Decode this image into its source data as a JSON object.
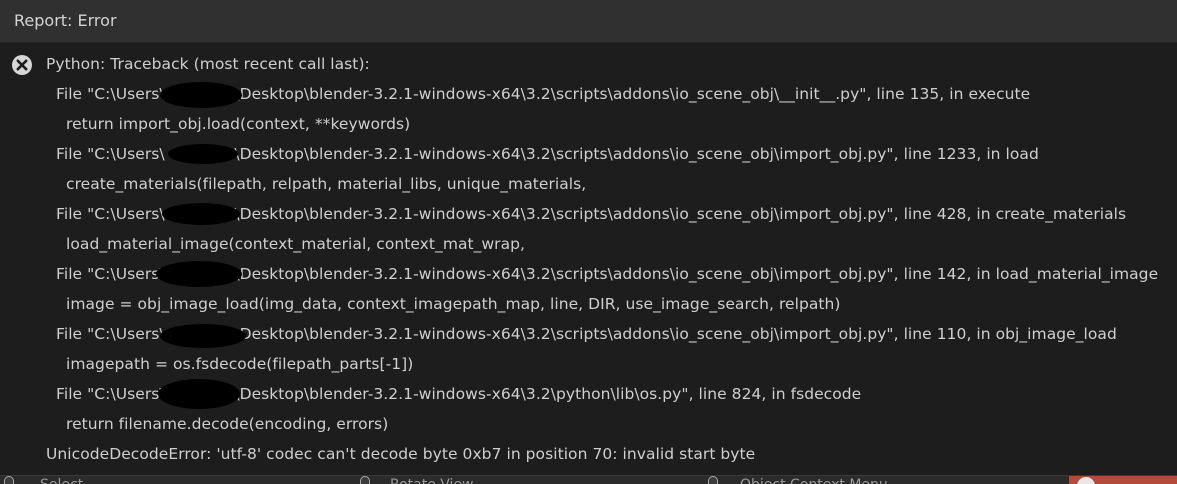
{
  "window": {
    "title": "Report: Error"
  },
  "report": {
    "icon": "error-x-icon",
    "lines": [
      "Python: Traceback (most recent call last):",
      "File \"C:\\Users\\              \\Desktop\\blender-3.2.1-windows-x64\\3.2\\scripts\\addons\\io_scene_obj\\__init__.py\", line 135, in execute",
      "return import_obj.load(context, **keywords)",
      "File \"C:\\Users\\              \\Desktop\\blender-3.2.1-windows-x64\\3.2\\scripts\\addons\\io_scene_obj\\import_obj.py\", line 1233, in load",
      "create_materials(filepath, relpath, material_libs, unique_materials,",
      "File \"C:\\Users\\              \\Desktop\\blender-3.2.1-windows-x64\\3.2\\scripts\\addons\\io_scene_obj\\import_obj.py\", line 428, in create_materials",
      "load_material_image(context_material, context_mat_wrap,",
      "File \"C:\\Users\\              \\Desktop\\blender-3.2.1-windows-x64\\3.2\\scripts\\addons\\io_scene_obj\\import_obj.py\", line 142, in load_material_image",
      "image = obj_image_load(img_data, context_imagepath_map, line, DIR, use_image_search, relpath)",
      "File \"C:\\Users\\              \\Desktop\\blender-3.2.1-windows-x64\\3.2\\scripts\\addons\\io_scene_obj\\import_obj.py\", line 110, in obj_image_load",
      "imagepath = os.fsdecode(filepath_parts[-1])",
      "File \"C:\\Users\\              \\Desktop\\blender-3.2.1-windows-x64\\3.2\\python\\lib\\os.py\", line 824, in fsdecode",
      "return filename.decode(encoding, errors)",
      "UnicodeDecodeError: 'utf-8' codec can't decode byte 0xb7 in position 70: invalid start byte"
    ]
  },
  "statusbar": {
    "items": [
      {
        "label": "Select",
        "icon": "mouse-left-icon"
      },
      {
        "label": "Rotate View",
        "icon": "mouse-middle-icon"
      },
      {
        "label": "Object Context Menu",
        "icon": "mouse-right-icon"
      }
    ],
    "error_icon": "error-x-icon",
    "error_color": "#b34a3a"
  },
  "colors": {
    "background": "#1d1d1d",
    "titlebar": "#303030",
    "text": "#cfcfcf"
  }
}
